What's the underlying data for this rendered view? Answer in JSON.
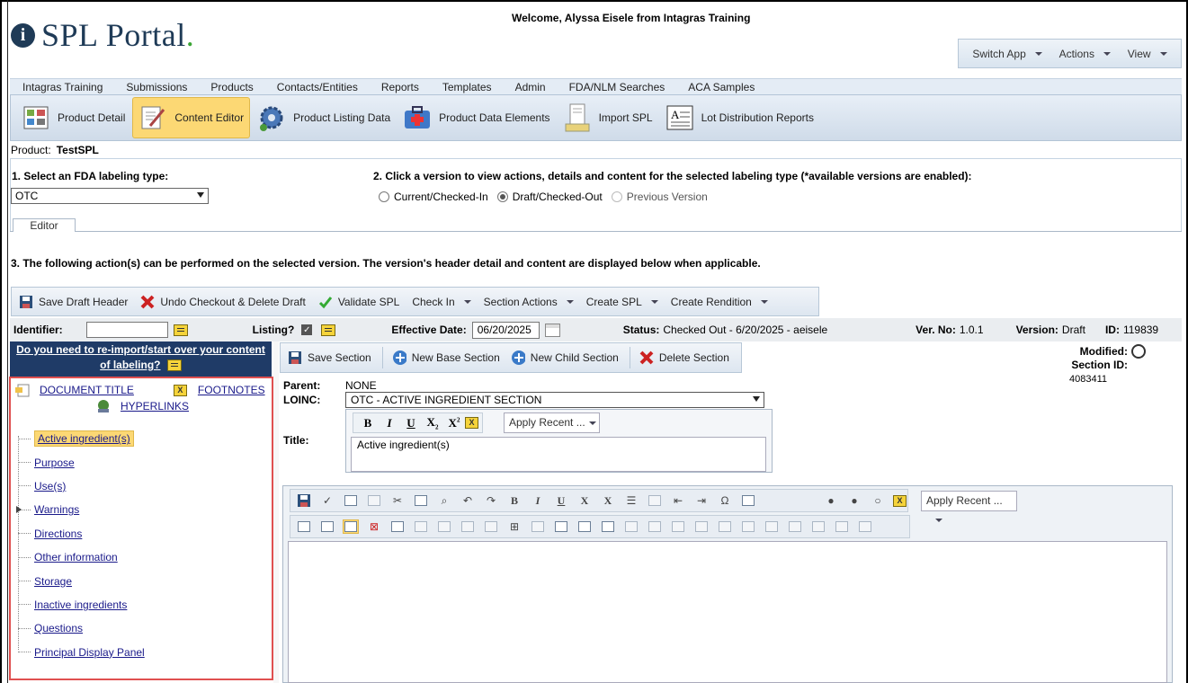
{
  "header": {
    "logo_text": "SPL Portal",
    "logo_dot": ".",
    "welcome": "Welcome, Alyssa Eisele from Intagras Training",
    "switch_menu": [
      "Switch App",
      "Actions",
      "View"
    ]
  },
  "menu": [
    "Intagras Training",
    "Submissions",
    "Products",
    "Contacts/Entities",
    "Reports",
    "Templates",
    "Admin",
    "FDA/NLM Searches",
    "ACA Samples"
  ],
  "toolbar": [
    {
      "label": "Product Detail",
      "icon": "product-detail-icon"
    },
    {
      "label": "Content Editor",
      "icon": "content-editor-icon",
      "active": true
    },
    {
      "label": "Product Listing Data",
      "icon": "gear-icon"
    },
    {
      "label": "Product Data Elements",
      "icon": "medical-kit-icon"
    },
    {
      "label": "Import SPL",
      "icon": "import-icon"
    },
    {
      "label": "Lot Distribution Reports",
      "icon": "document-icon"
    }
  ],
  "product": {
    "label": "Product:",
    "value": "TestSPL"
  },
  "step1": {
    "label": "1. Select an FDA labeling type:",
    "selected": "OTC"
  },
  "step2": {
    "label": "2. Click a version to view actions, details and content for the selected labeling type (*available versions are enabled):",
    "options": [
      "Current/Checked-In",
      "Draft/Checked-Out",
      "Previous Version"
    ],
    "selected": "Draft/Checked-Out"
  },
  "tab": "Editor",
  "step3": "3. The following action(s) can be performed on the selected version. The version's header detail and content are displayed below when applicable.",
  "actions": [
    "Save Draft Header",
    "Undo Checkout & Delete Draft",
    "Validate SPL",
    "Check In",
    "Section Actions",
    "Create SPL",
    "Create Rendition"
  ],
  "info": {
    "identifier_label": "Identifier:",
    "identifier_value": "",
    "listing_label": "Listing?",
    "effective_label": "Effective Date:",
    "effective_value": "06/20/2025",
    "status_label": "Status:",
    "status_value": "Checked Out - 6/20/2025 - aeisele",
    "verno_label": "Ver. No:",
    "verno_value": "1.0.1",
    "version_label": "Version:",
    "version_value": "Draft",
    "id_label": "ID:",
    "id_value": "119839"
  },
  "reimport": {
    "line1": "Do you need to re-import/start over your content",
    "line2": "of labeling?"
  },
  "doclinks": {
    "title": "DOCUMENT TITLE",
    "footnotes": "FOOTNOTES",
    "hyperlinks": "HYPERLINKS"
  },
  "sections": [
    "Active ingredient(s)",
    "Purpose",
    "Use(s)",
    "Warnings",
    "Directions",
    "Other information",
    "Storage",
    "Inactive ingredients",
    "Questions",
    "Principal Display Panel"
  ],
  "section_actions": [
    "Save Section",
    "New Base Section",
    "New Child Section",
    "Delete Section"
  ],
  "section_meta": {
    "modified_label": "Modified:",
    "section_id_label": "Section ID:",
    "section_id_value": "4083411",
    "parent_label": "Parent:",
    "parent_value": "NONE",
    "loinc_label": "LOINC:",
    "loinc_value": "OTC - ACTIVE INGREDIENT SECTION",
    "title_label": "Title:",
    "title_value": "Active ingredient(s)"
  },
  "apply_recent": "Apply Recent ...",
  "colors": {
    "navy": "#1f3b67",
    "highlight": "#fcd874",
    "logo": "#1f3b57",
    "accent_green": "#3aa534",
    "red_border": "#e05050"
  }
}
